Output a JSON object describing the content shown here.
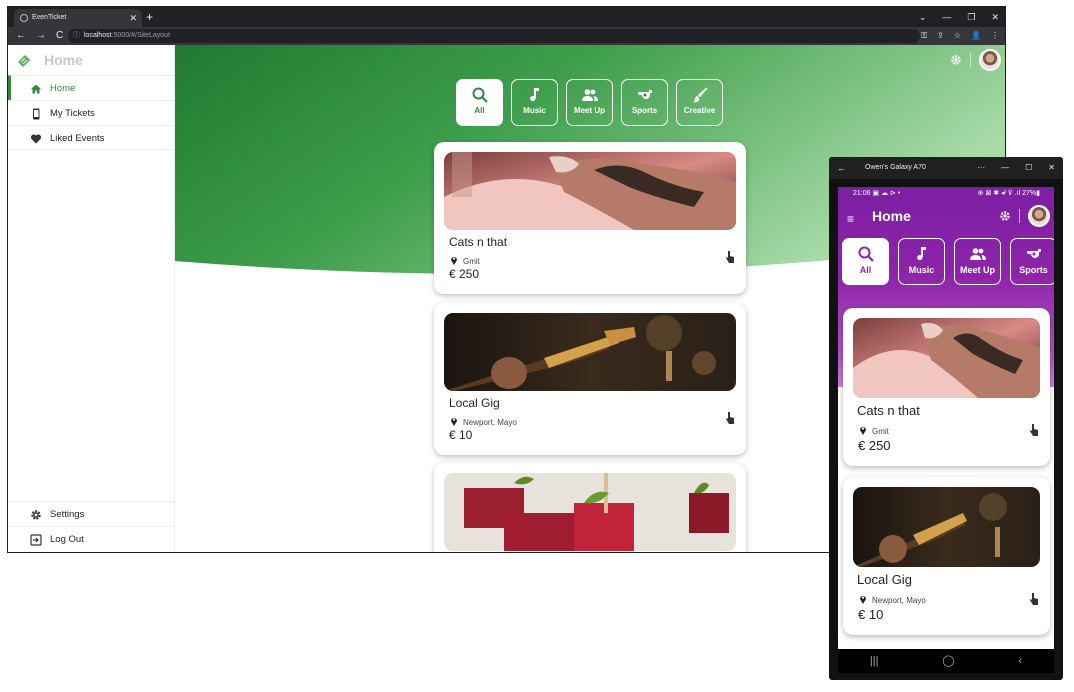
{
  "browser": {
    "tab_title": "EvenTicket",
    "tab_close": "✕",
    "new_tab": "+",
    "controls": [
      "⌄",
      "—",
      "❐",
      "✕"
    ],
    "nav": [
      "←",
      "→",
      "C"
    ],
    "url_host": "localhost",
    "url_path": ":5000/#/SiteLayout",
    "addr_icons": [
      "⚿",
      "⇪",
      "☆",
      "👤",
      "⋮"
    ]
  },
  "sidebar": {
    "brand": "Home",
    "items": [
      {
        "label": "Home",
        "icon": "home-icon",
        "active": true
      },
      {
        "label": "My Tickets",
        "icon": "phone-icon"
      },
      {
        "label": "Liked Events",
        "icon": "heart-icon"
      }
    ],
    "bottom": [
      {
        "label": "Settings",
        "icon": "gear-icon"
      },
      {
        "label": "Log Out",
        "icon": "logout-icon"
      }
    ]
  },
  "categories": [
    {
      "label": "All",
      "icon": "search-icon"
    },
    {
      "label": "Music",
      "icon": "music-note-icon"
    },
    {
      "label": "Meet Up",
      "icon": "people-icon"
    },
    {
      "label": "Sports",
      "icon": "whistle-icon"
    },
    {
      "label": "Creative",
      "icon": "brush-icon"
    }
  ],
  "events": [
    {
      "title": "Cats n that",
      "location": "Gmit",
      "price": "€ 250",
      "image": "cat-photo"
    },
    {
      "title": "Local Gig",
      "location": "Newport, Mayo",
      "price": "€ 10",
      "image": "guitar-photo"
    },
    {
      "title": "",
      "location": "",
      "price": "",
      "image": "food-photo"
    }
  ],
  "phone": {
    "window_title": "Owen's Galaxy A70",
    "controls": [
      "···",
      "—",
      "☐",
      "✕"
    ],
    "back": "←",
    "time": "21:06",
    "status_icons": "▣ ☁ ⊳ •",
    "system": "⊕ ⊠ ✱ ◂ᴵ ⊽ .ıl 27%▮",
    "header_title": "Home",
    "hamburger": "≡",
    "categories": [
      {
        "label": "All",
        "icon": "search-icon"
      },
      {
        "label": "Music",
        "icon": "music-note-icon"
      },
      {
        "label": "Meet Up",
        "icon": "people-icon"
      },
      {
        "label": "Sports",
        "icon": "whistle-icon"
      }
    ],
    "nav_buttons": [
      "|||",
      "◯",
      "‹"
    ]
  },
  "colors": {
    "green_dark": "#2e8b3e",
    "green_light": "#a5d6a7",
    "purple": "#8e24aa"
  }
}
